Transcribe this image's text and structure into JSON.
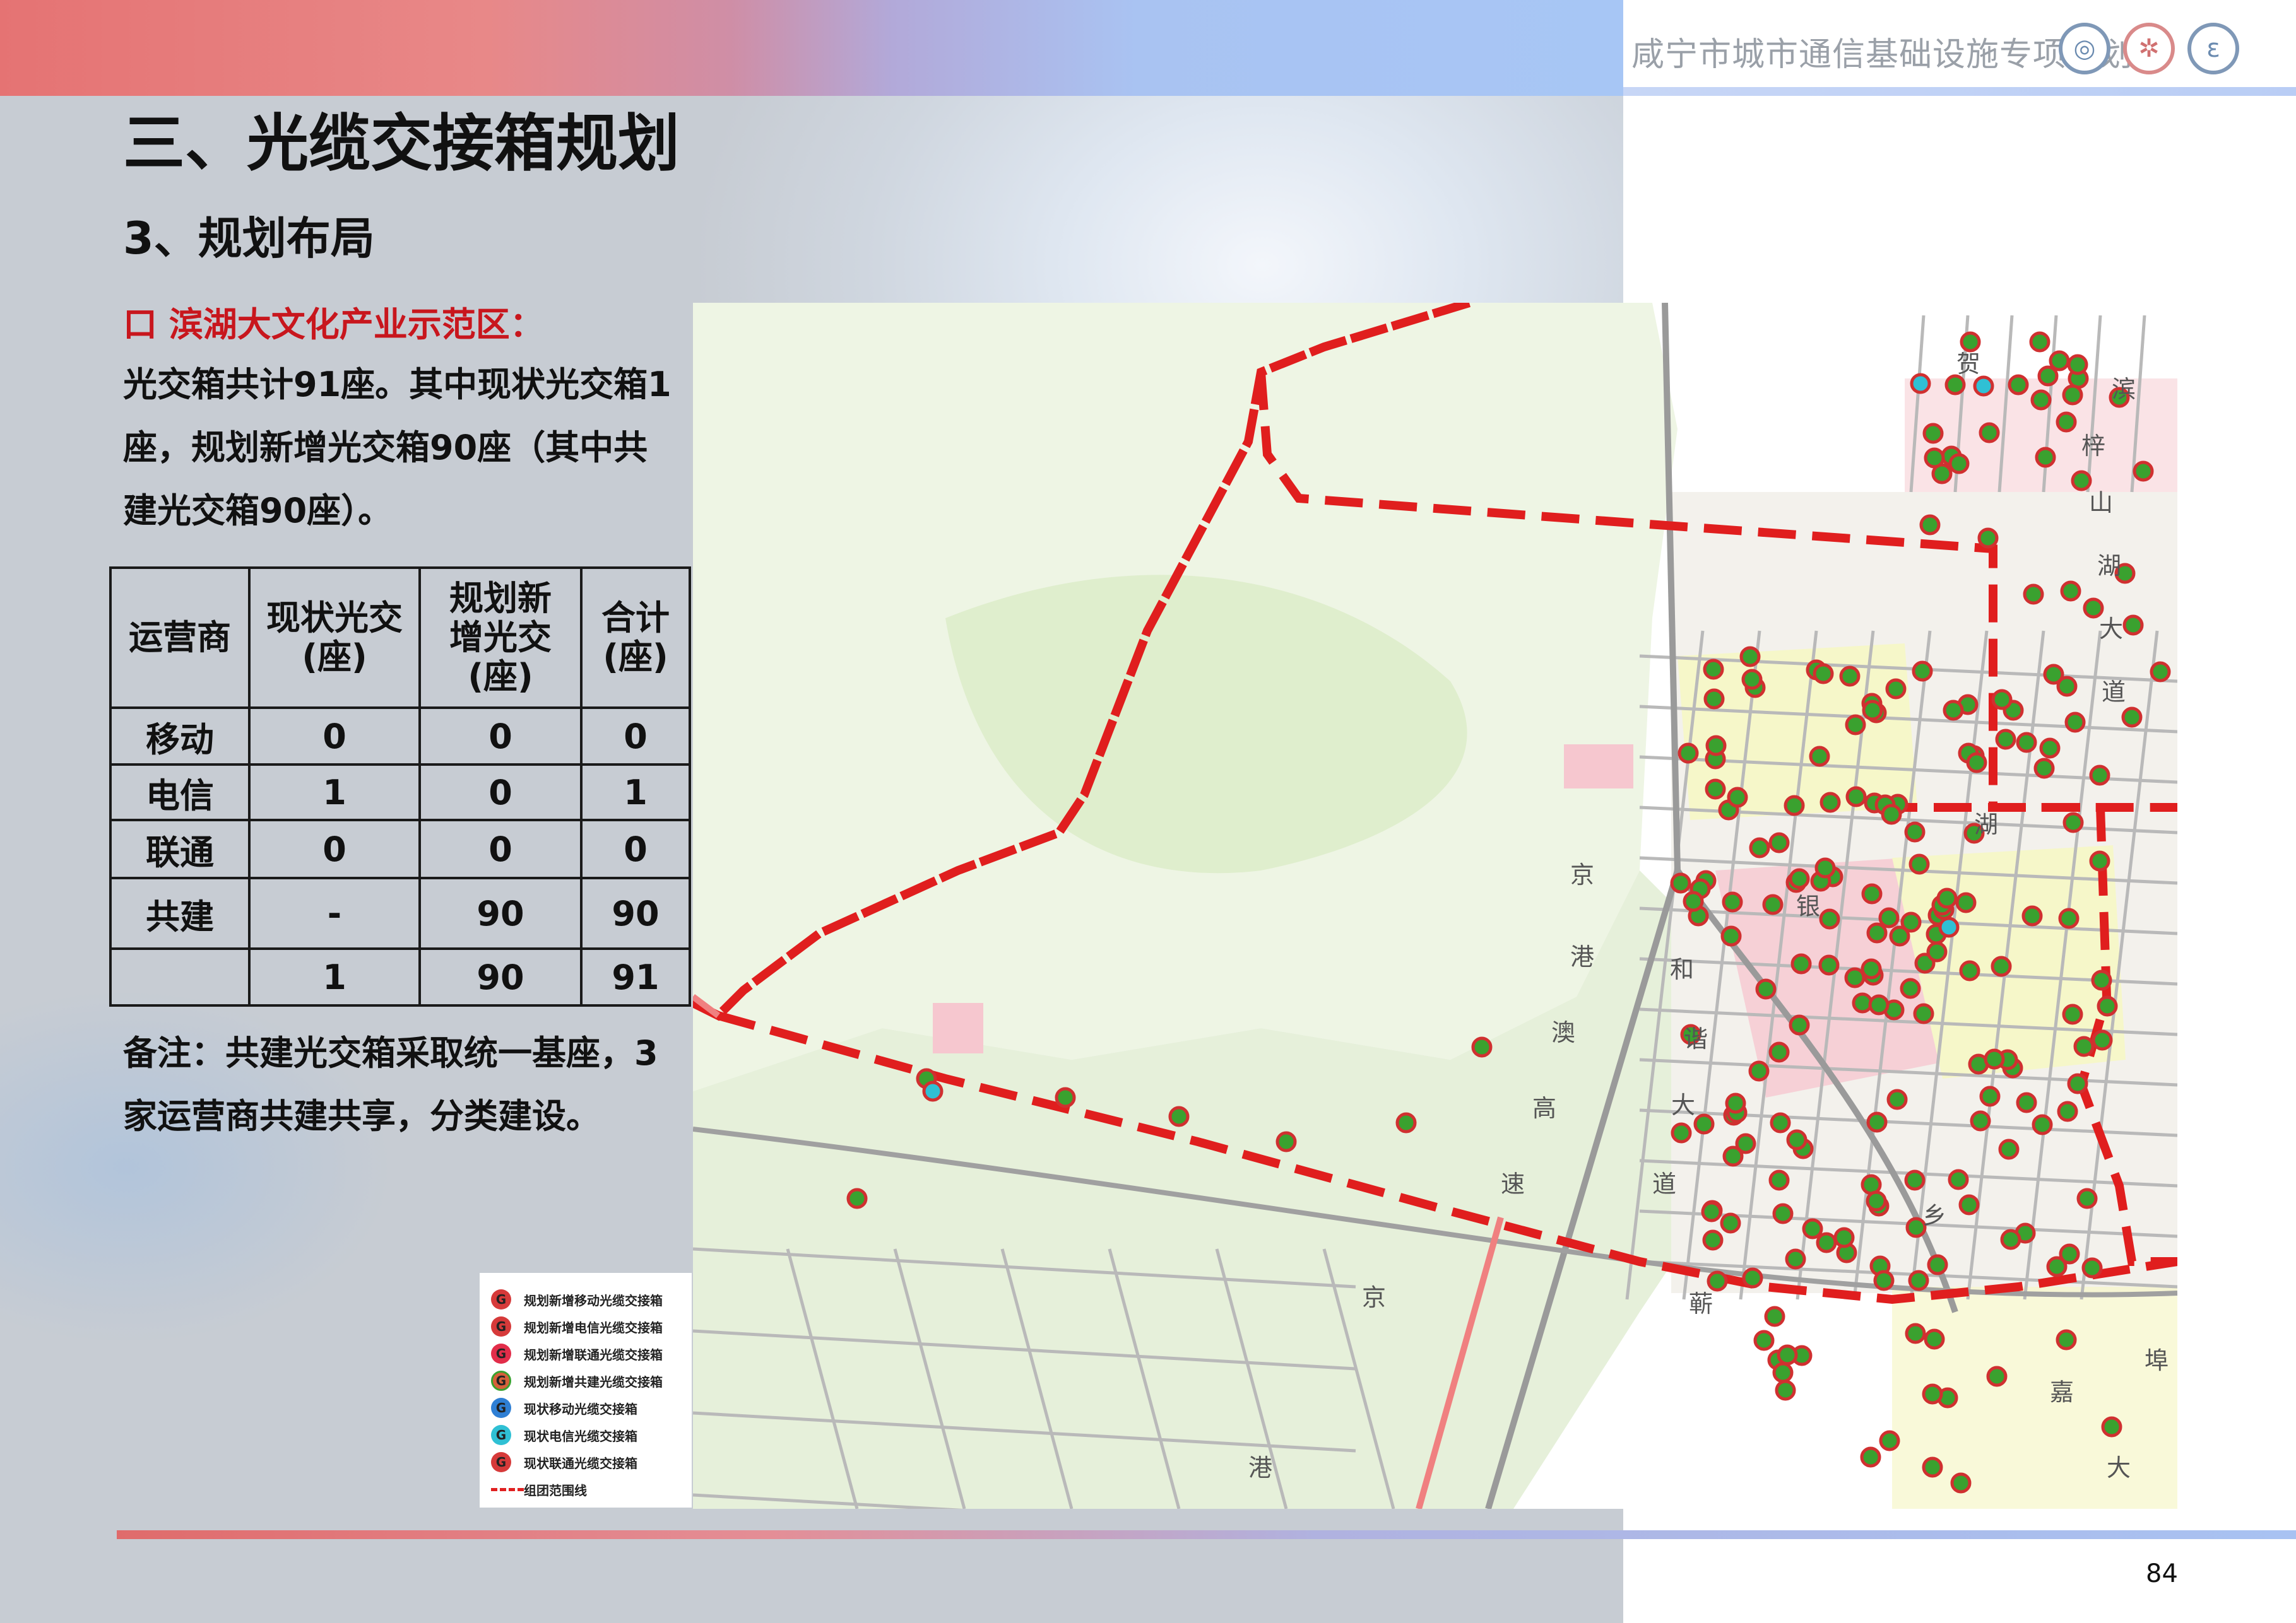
{
  "header": {
    "title": "咸宁市城市通信基础设施专项规划",
    "logos": [
      "china-mobile-logo-icon",
      "china-unicom-logo-icon",
      "china-telecom-logo-icon"
    ]
  },
  "section_title": "三、光缆交接箱规划",
  "subsection_title": "3、规划布局",
  "district_heading": "口 滨湖大文化产业示范区：",
  "summary_lines": [
    "光交箱共计91座。其中现状光交箱1",
    "座，规划新增光交箱90座（其中共",
    "建光交箱90座）。"
  ],
  "table": {
    "headers": [
      "运营商",
      "现状光交\n(座)",
      "规划新\n增光交\n(座)",
      "合计\n(座)"
    ],
    "rows": [
      [
        "移动",
        "0",
        "0",
        "0"
      ],
      [
        "电信",
        "1",
        "0",
        "1"
      ],
      [
        "联通",
        "0",
        "0",
        "0"
      ],
      [
        "共建",
        "-",
        "90",
        "90"
      ],
      [
        "",
        "1",
        "90",
        "91"
      ]
    ]
  },
  "note_lines": [
    "备注：共建光交箱采取统一基座，3",
    "家运营商共建共享，分类建设。"
  ],
  "map": {
    "road_labels": [
      {
        "text": "京"
      },
      {
        "text": "港"
      },
      {
        "text": "澳"
      },
      {
        "text": "高"
      },
      {
        "text": "速"
      },
      {
        "text": "和"
      },
      {
        "text": "谐"
      },
      {
        "text": "大"
      },
      {
        "text": "道"
      },
      {
        "text": "银"
      },
      {
        "text": "湖"
      },
      {
        "text": "乡"
      },
      {
        "text": "京"
      },
      {
        "text": "港"
      },
      {
        "text": "蕲"
      },
      {
        "text": "嘉"
      },
      {
        "text": "埠"
      },
      {
        "text": "大"
      },
      {
        "text": "贺"
      },
      {
        "text": "滨"
      },
      {
        "text": "梓"
      },
      {
        "text": "山"
      },
      {
        "text": "湖"
      },
      {
        "text": "大"
      },
      {
        "text": "道"
      }
    ],
    "colors": {
      "boundary": "#e01e1e",
      "new_shared_box": "#3aa12f",
      "existing_telecom_box": "#2fc0d4",
      "land_green": "#dfeecd",
      "land_yellow": "#f6f7c9",
      "land_pink": "#f6d0d6"
    }
  },
  "legend": {
    "items": [
      {
        "label": "规划新增移动光缆交接箱",
        "color": "#d63a3a"
      },
      {
        "label": "规划新增电信光缆交接箱",
        "color": "#d63a3a"
      },
      {
        "label": "规划新增联通光缆交接箱",
        "color": "#d63a3a"
      },
      {
        "label": "规划新增共建光缆交接箱",
        "color": "#3aa12f"
      },
      {
        "label": "现状移动光缆交接箱",
        "color": "#2f7fd4"
      },
      {
        "label": "现状电信光缆交接箱",
        "color": "#2fc0d4"
      },
      {
        "label": "现状联通光缆交接箱",
        "color": "#d63a3a"
      },
      {
        "label": "组团范围线",
        "color": "#e02020"
      }
    ],
    "marker_glyph": "G"
  },
  "page_number": "84"
}
